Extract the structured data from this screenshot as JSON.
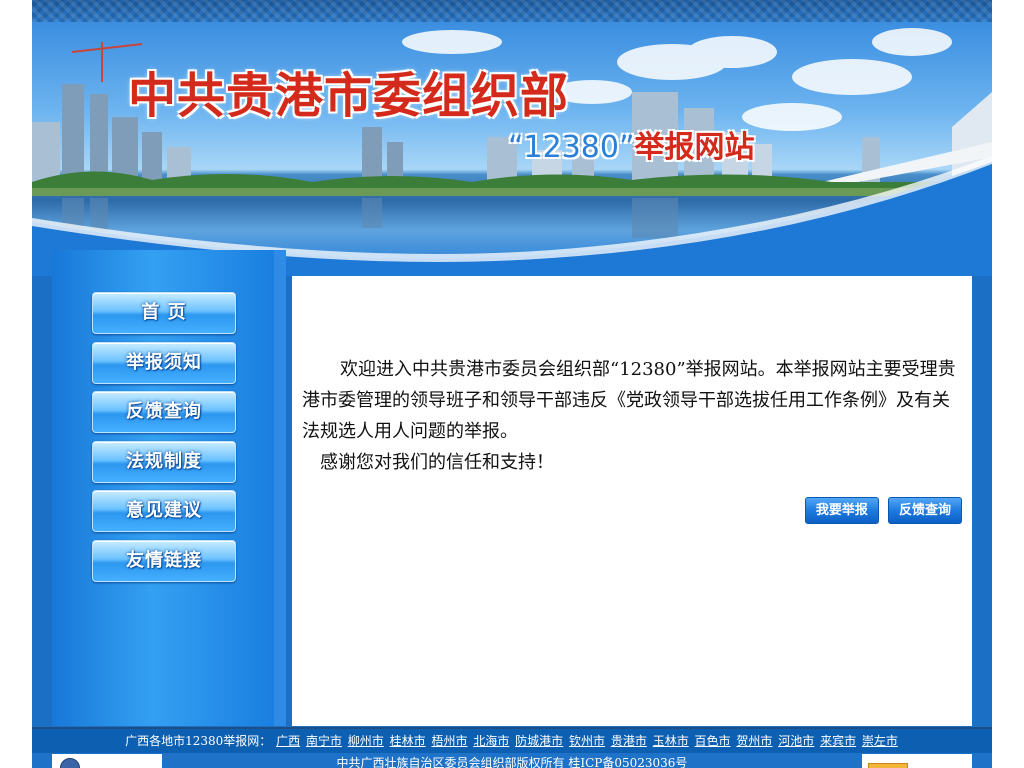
{
  "banner": {
    "title": "中共贵港市委组织部",
    "subtitle_quote_number": "“12380”",
    "subtitle_words": "举报网站"
  },
  "nav": {
    "items": [
      {
        "label": "首 页"
      },
      {
        "label": "举报须知"
      },
      {
        "label": "反馈查询"
      },
      {
        "label": "法规制度"
      },
      {
        "label": "意见建议"
      },
      {
        "label": "友情链接"
      }
    ]
  },
  "main": {
    "intro": "欢迎进入中共贵港市委员会组织部“12380”举报网站。本举报网站主要受理贵港市委管理的领导班子和领导干部违反《党政领导干部选拔任用工作条例》及有关法规选人用人问题的举报。",
    "thanks": "感谢您对我们的信任和支持！",
    "report_button": "我要举报",
    "feedback_button": "反馈查询"
  },
  "footer": {
    "links_label": "广西各地市12380举报网：",
    "links": [
      "广西",
      "南宁市",
      "柳州市",
      "桂林市",
      "梧州市",
      "北海市",
      "防城港市",
      "钦州市",
      "贵港市",
      "玉林市",
      "百色市",
      "贺州市",
      "河池市",
      "来宾市",
      "崇左市"
    ],
    "copyright": "中共广西壮族自治区委员会组织部版权所有 桂ICP备05023036号"
  },
  "colors": {
    "page_blue": "#1b6fc4",
    "title_red": "#d42a1c",
    "nav_button_blue": "#45b0ff"
  }
}
